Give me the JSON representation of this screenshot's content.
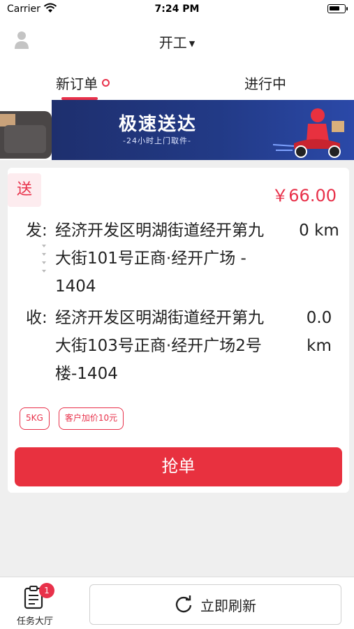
{
  "status_bar": {
    "carrier": "Carrier",
    "time": "7:24 PM"
  },
  "nav": {
    "title": "开工"
  },
  "tabs": [
    {
      "label": "新订单",
      "active": true
    },
    {
      "label": "进行中",
      "active": false
    }
  ],
  "banner": {
    "title": "极速送达",
    "subtitle": "-24小时上门取件-"
  },
  "order": {
    "badge": "送",
    "price": "￥66.00",
    "from": {
      "label": "发:",
      "address": "经济开发区明湖街道经开第九大街101号正商·经开广场 - 1404",
      "distance": "0 km"
    },
    "to": {
      "label": "收:",
      "address": "经济开发区明湖街道经开第九大街103号正商·经开广场2号楼-1404",
      "distance": "0.0 km"
    },
    "tags": [
      "5KG",
      "客户加价10元"
    ],
    "grab_label": "抢单"
  },
  "bottom": {
    "hall_label": "任务大厅",
    "hall_badge": "1",
    "refresh_label": "立即刷新"
  },
  "colors": {
    "accent": "#e8314a",
    "banner_bg": "#223a86"
  }
}
